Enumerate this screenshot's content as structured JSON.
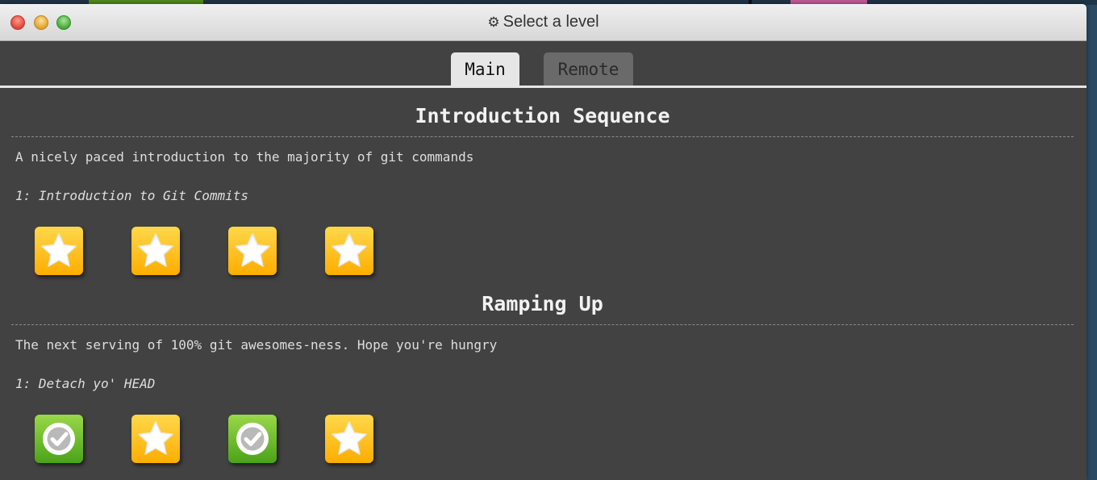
{
  "window": {
    "title": "Select a level",
    "title_icon": "gear-icon"
  },
  "tabs": [
    {
      "label": "Main",
      "active": true
    },
    {
      "label": "Remote",
      "active": false
    }
  ],
  "sequences": [
    {
      "title": "Introduction Sequence",
      "description": "A nicely paced introduction to the majority of git commands",
      "level_name": "1: Introduction to Git Commits",
      "levels": [
        "star",
        "star",
        "star",
        "star"
      ]
    },
    {
      "title": "Ramping Up",
      "description": "The next serving of 100% git awesomes-ness. Hope you're hungry",
      "level_name": "1: Detach yo' HEAD",
      "levels": [
        "completed",
        "star",
        "completed",
        "star"
      ]
    }
  ],
  "colors": {
    "star_tile": "#ffb300",
    "completed_tile": "#5cb21f",
    "panel_bg": "#424242"
  }
}
